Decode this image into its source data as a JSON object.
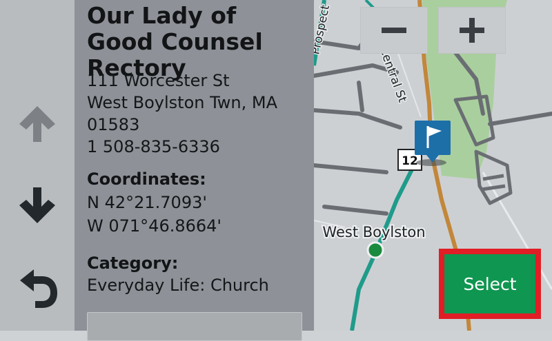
{
  "place": {
    "name": "Our Lady of Good Counsel Rectory",
    "address_line1": "111 Worcester St",
    "address_line2": "West Boylston Twn, MA",
    "address_line3": "01583",
    "phone": "1 508-835-6336"
  },
  "coordinates": {
    "heading": "Coordinates:",
    "lat": "N 42°21.7093'",
    "lon": "W 071°46.8664'"
  },
  "category": {
    "heading": "Category:",
    "value": "Everyday Life: Church"
  },
  "map": {
    "road_central": "Central St",
    "road_prospect": "Prospect",
    "route_shield": "12",
    "town_label": "West Boylston"
  },
  "nav": {
    "up_icon": "arrow-up-icon",
    "down_icon": "arrow-down-icon",
    "back_icon": "back-arrow-icon"
  },
  "zoom": {
    "out_label": "−",
    "in_label": "+"
  },
  "actions": {
    "select_label": "Select"
  },
  "colors": {
    "select_bg": "#0f9650",
    "highlight": "#e11d25",
    "flag_marker": "#1d6fa8",
    "route_orange": "#c2873a",
    "teal_road": "#1f9b8a",
    "park_green": "#a9cf9e"
  }
}
